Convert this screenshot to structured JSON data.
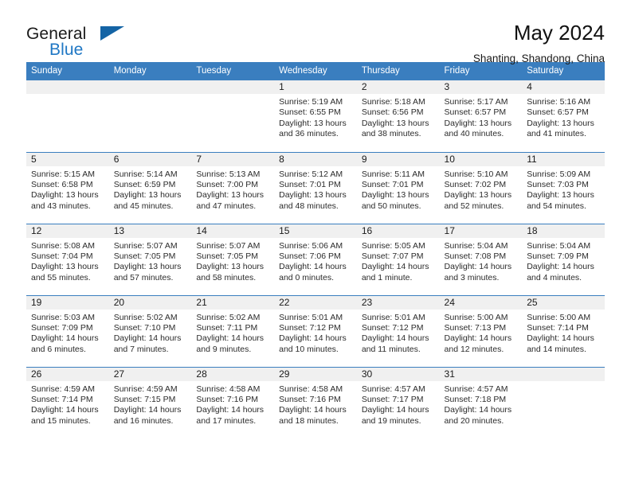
{
  "brand": {
    "name_top": "General",
    "name_bottom": "Blue",
    "triangle_color": "#1464a5",
    "blue_color": "#1f77c4"
  },
  "header": {
    "title": "May 2024",
    "location": "Shanting, Shandong, China"
  },
  "theme": {
    "header_blue": "#3a7ebf",
    "daynum_band": "#f0f0f0",
    "text": "#2b2b2b"
  },
  "calendar": {
    "weekday_headers": [
      "Sunday",
      "Monday",
      "Tuesday",
      "Wednesday",
      "Thursday",
      "Friday",
      "Saturday"
    ],
    "weeks": [
      [
        {
          "day": "",
          "lines": []
        },
        {
          "day": "",
          "lines": []
        },
        {
          "day": "",
          "lines": []
        },
        {
          "day": "1",
          "lines": [
            "Sunrise: 5:19 AM",
            "Sunset: 6:55 PM",
            "Daylight: 13 hours",
            "and 36 minutes."
          ]
        },
        {
          "day": "2",
          "lines": [
            "Sunrise: 5:18 AM",
            "Sunset: 6:56 PM",
            "Daylight: 13 hours",
            "and 38 minutes."
          ]
        },
        {
          "day": "3",
          "lines": [
            "Sunrise: 5:17 AM",
            "Sunset: 6:57 PM",
            "Daylight: 13 hours",
            "and 40 minutes."
          ]
        },
        {
          "day": "4",
          "lines": [
            "Sunrise: 5:16 AM",
            "Sunset: 6:57 PM",
            "Daylight: 13 hours",
            "and 41 minutes."
          ]
        }
      ],
      [
        {
          "day": "5",
          "lines": [
            "Sunrise: 5:15 AM",
            "Sunset: 6:58 PM",
            "Daylight: 13 hours",
            "and 43 minutes."
          ]
        },
        {
          "day": "6",
          "lines": [
            "Sunrise: 5:14 AM",
            "Sunset: 6:59 PM",
            "Daylight: 13 hours",
            "and 45 minutes."
          ]
        },
        {
          "day": "7",
          "lines": [
            "Sunrise: 5:13 AM",
            "Sunset: 7:00 PM",
            "Daylight: 13 hours",
            "and 47 minutes."
          ]
        },
        {
          "day": "8",
          "lines": [
            "Sunrise: 5:12 AM",
            "Sunset: 7:01 PM",
            "Daylight: 13 hours",
            "and 48 minutes."
          ]
        },
        {
          "day": "9",
          "lines": [
            "Sunrise: 5:11 AM",
            "Sunset: 7:01 PM",
            "Daylight: 13 hours",
            "and 50 minutes."
          ]
        },
        {
          "day": "10",
          "lines": [
            "Sunrise: 5:10 AM",
            "Sunset: 7:02 PM",
            "Daylight: 13 hours",
            "and 52 minutes."
          ]
        },
        {
          "day": "11",
          "lines": [
            "Sunrise: 5:09 AM",
            "Sunset: 7:03 PM",
            "Daylight: 13 hours",
            "and 54 minutes."
          ]
        }
      ],
      [
        {
          "day": "12",
          "lines": [
            "Sunrise: 5:08 AM",
            "Sunset: 7:04 PM",
            "Daylight: 13 hours",
            "and 55 minutes."
          ]
        },
        {
          "day": "13",
          "lines": [
            "Sunrise: 5:07 AM",
            "Sunset: 7:05 PM",
            "Daylight: 13 hours",
            "and 57 minutes."
          ]
        },
        {
          "day": "14",
          "lines": [
            "Sunrise: 5:07 AM",
            "Sunset: 7:05 PM",
            "Daylight: 13 hours",
            "and 58 minutes."
          ]
        },
        {
          "day": "15",
          "lines": [
            "Sunrise: 5:06 AM",
            "Sunset: 7:06 PM",
            "Daylight: 14 hours",
            "and 0 minutes."
          ]
        },
        {
          "day": "16",
          "lines": [
            "Sunrise: 5:05 AM",
            "Sunset: 7:07 PM",
            "Daylight: 14 hours",
            "and 1 minute."
          ]
        },
        {
          "day": "17",
          "lines": [
            "Sunrise: 5:04 AM",
            "Sunset: 7:08 PM",
            "Daylight: 14 hours",
            "and 3 minutes."
          ]
        },
        {
          "day": "18",
          "lines": [
            "Sunrise: 5:04 AM",
            "Sunset: 7:09 PM",
            "Daylight: 14 hours",
            "and 4 minutes."
          ]
        }
      ],
      [
        {
          "day": "19",
          "lines": [
            "Sunrise: 5:03 AM",
            "Sunset: 7:09 PM",
            "Daylight: 14 hours",
            "and 6 minutes."
          ]
        },
        {
          "day": "20",
          "lines": [
            "Sunrise: 5:02 AM",
            "Sunset: 7:10 PM",
            "Daylight: 14 hours",
            "and 7 minutes."
          ]
        },
        {
          "day": "21",
          "lines": [
            "Sunrise: 5:02 AM",
            "Sunset: 7:11 PM",
            "Daylight: 14 hours",
            "and 9 minutes."
          ]
        },
        {
          "day": "22",
          "lines": [
            "Sunrise: 5:01 AM",
            "Sunset: 7:12 PM",
            "Daylight: 14 hours",
            "and 10 minutes."
          ]
        },
        {
          "day": "23",
          "lines": [
            "Sunrise: 5:01 AM",
            "Sunset: 7:12 PM",
            "Daylight: 14 hours",
            "and 11 minutes."
          ]
        },
        {
          "day": "24",
          "lines": [
            "Sunrise: 5:00 AM",
            "Sunset: 7:13 PM",
            "Daylight: 14 hours",
            "and 12 minutes."
          ]
        },
        {
          "day": "25",
          "lines": [
            "Sunrise: 5:00 AM",
            "Sunset: 7:14 PM",
            "Daylight: 14 hours",
            "and 14 minutes."
          ]
        }
      ],
      [
        {
          "day": "26",
          "lines": [
            "Sunrise: 4:59 AM",
            "Sunset: 7:14 PM",
            "Daylight: 14 hours",
            "and 15 minutes."
          ]
        },
        {
          "day": "27",
          "lines": [
            "Sunrise: 4:59 AM",
            "Sunset: 7:15 PM",
            "Daylight: 14 hours",
            "and 16 minutes."
          ]
        },
        {
          "day": "28",
          "lines": [
            "Sunrise: 4:58 AM",
            "Sunset: 7:16 PM",
            "Daylight: 14 hours",
            "and 17 minutes."
          ]
        },
        {
          "day": "29",
          "lines": [
            "Sunrise: 4:58 AM",
            "Sunset: 7:16 PM",
            "Daylight: 14 hours",
            "and 18 minutes."
          ]
        },
        {
          "day": "30",
          "lines": [
            "Sunrise: 4:57 AM",
            "Sunset: 7:17 PM",
            "Daylight: 14 hours",
            "and 19 minutes."
          ]
        },
        {
          "day": "31",
          "lines": [
            "Sunrise: 4:57 AM",
            "Sunset: 7:18 PM",
            "Daylight: 14 hours",
            "and 20 minutes."
          ]
        },
        {
          "day": "",
          "lines": []
        }
      ]
    ]
  }
}
